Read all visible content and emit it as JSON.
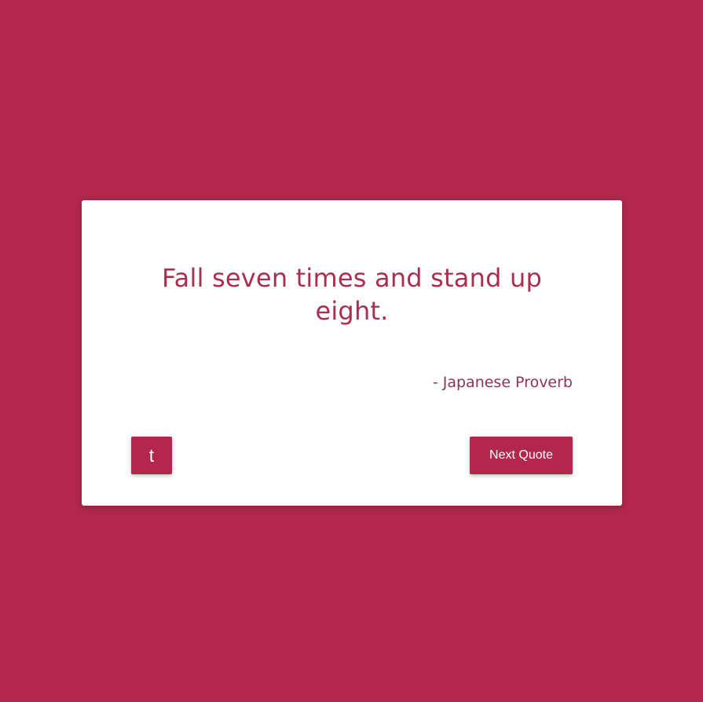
{
  "colors": {
    "background": "#b1284a",
    "card": "#ffffff",
    "quote_text": "#a8304e",
    "author_text": "#8e3452",
    "button": "#b1284a",
    "button_text": "#ffffff"
  },
  "quote": {
    "text": "Fall seven times and stand up eight.",
    "author": "- Japanese Proverb"
  },
  "buttons": {
    "tweet": {
      "label": "t",
      "icon": "tumblr-icon"
    },
    "next_quote": {
      "label": "Next Quote"
    }
  }
}
